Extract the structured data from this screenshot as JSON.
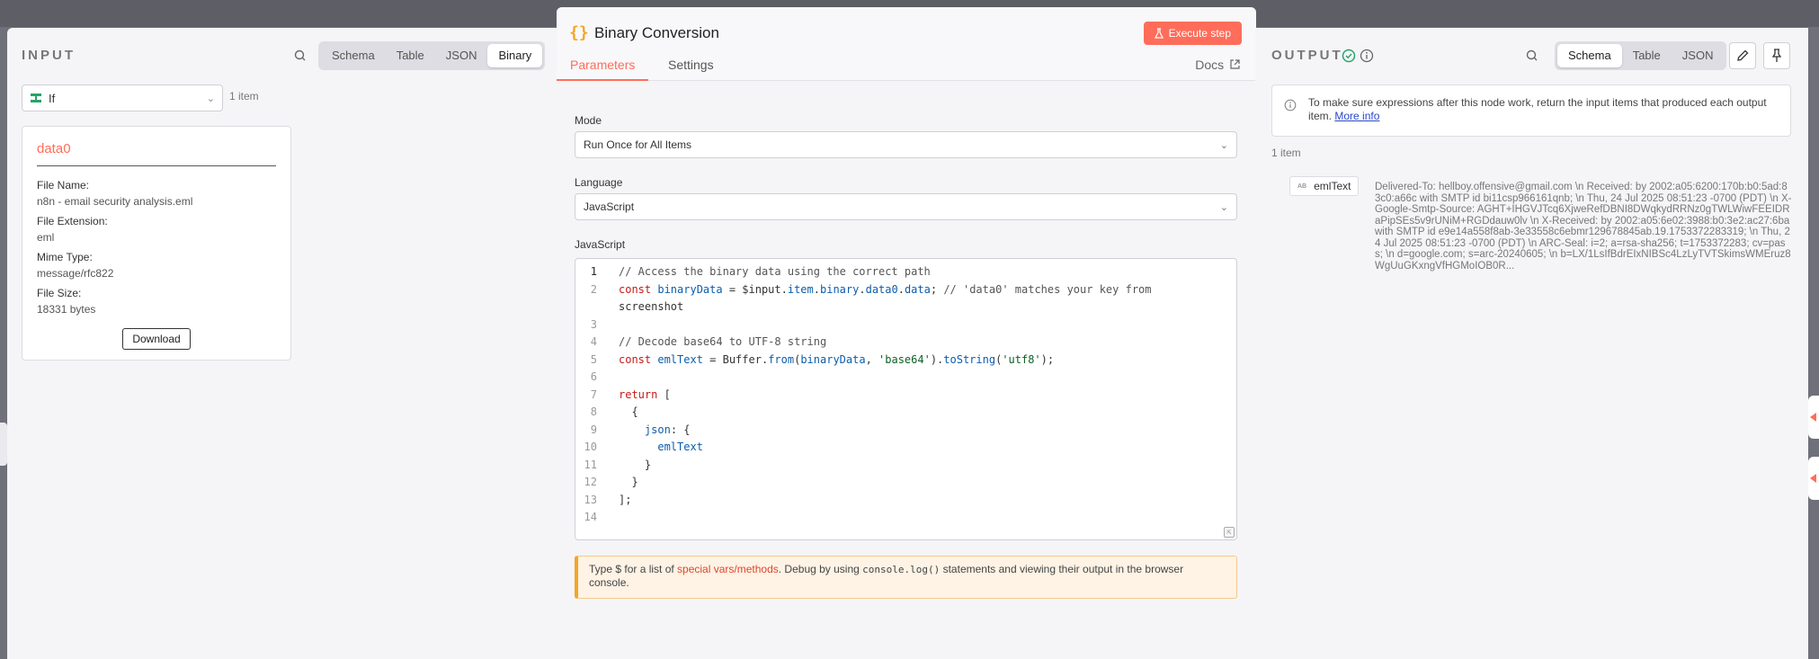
{
  "input_panel": {
    "title": "INPUT",
    "view_options": [
      "Schema",
      "Table",
      "JSON",
      "Binary"
    ],
    "active_view": "Binary",
    "source_node": "If",
    "item_count": "1 item",
    "binary_card": {
      "title": "data0",
      "file_name_label": "File Name:",
      "file_name": "n8n - email security analysis.eml",
      "file_extension_label": "File Extension:",
      "file_extension": "eml",
      "mime_type_label": "Mime Type:",
      "mime_type": "message/rfc822",
      "file_size_label": "File Size:",
      "file_size": "18331 bytes",
      "download_label": "Download"
    }
  },
  "node": {
    "icon": "{}",
    "title": "Binary Conversion",
    "execute_label": "Execute step",
    "tabs": [
      "Parameters",
      "Settings"
    ],
    "active_tab": "Parameters",
    "docs_label": "Docs",
    "mode_label": "Mode",
    "mode_value": "Run Once for All Items",
    "language_label": "Language",
    "language_value": "JavaScript",
    "code_label": "JavaScript",
    "code_lines": [
      "// Access the binary data using the correct path",
      "const binaryData = $input.item.binary.data0.data; // 'data0' matches your key from",
      "screenshot",
      "",
      "// Decode base64 to UTF-8 string",
      "const emlText = Buffer.from(binaryData, 'base64').toString('utf8');",
      "",
      "return [",
      "  {",
      "    json: {",
      "      emlText",
      "    }",
      "  }",
      "];",
      ""
    ],
    "line_numbers": [
      "1",
      "2",
      "",
      "3",
      "4",
      "5",
      "6",
      "7",
      "8",
      "9",
      "10",
      "11",
      "12",
      "13",
      "14"
    ],
    "hint": {
      "prefix": "Type $ for a list of ",
      "link": "special vars/methods",
      "middle": ". Debug by using ",
      "code": "console.log()",
      "suffix": " statements and viewing their output in the browser console."
    }
  },
  "output_panel": {
    "title": "OUTPUT",
    "view_options": [
      "Schema",
      "Table",
      "JSON"
    ],
    "active_view": "Schema",
    "banner_text": "To make sure expressions after this node work, return the input items that produced each output item.",
    "banner_link": "More info",
    "item_count": "1 item",
    "field_type": "AB",
    "field_name": "emlText",
    "field_value": "Delivered-To: hellboy.offensive@gmail.com \\n Received: by 2002:a05:6200:170b:b0:5ad:83c0:a66c with SMTP id bi11csp966161qnb; \\n Thu, 24 Jul 2025 08:51:23 -0700 (PDT) \\n X-Google-Smtp-Source: AGHT+IHGVJTcq6XjweRefDBNI8DWqkydRRNz0gTWLWiwFEEIDRaPipSEs5v9rUNiM+RGDdauw0lv \\n X-Received: by 2002:a05:6e02:3988:b0:3e2:ac27:6ba with SMTP id e9e14a558f8ab-3e33558c6ebmr129678845ab.19.1753372283319; \\n Thu, 24 Jul 2025 08:51:23 -0700 (PDT) \\n ARC-Seal: i=2; a=rsa-sha256; t=1753372283; cv=pass; \\n d=google.com; s=arc-20240605; \\n b=LX/1LsIfBdrEIxNIBSc4LzLyTVTSkimsWMEruz8WgUuGKxngVfHGMoIOB0R..."
  },
  "colors": {
    "accent": "#ff6d5a",
    "success": "#29a36a",
    "link": "#2948c9"
  }
}
